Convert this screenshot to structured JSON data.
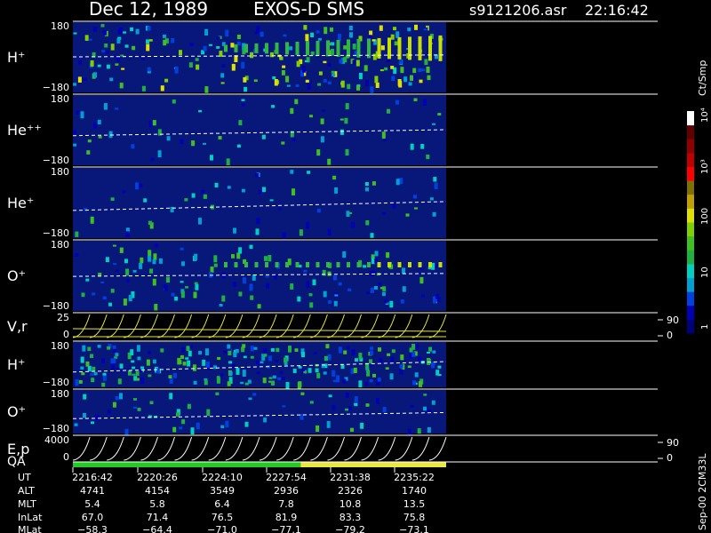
{
  "header": {
    "date": "Dec 12, 1989",
    "instrument": "EXOS-D SMS",
    "file": "s9121206.asr",
    "time": "22:16:42"
  },
  "colorbar": {
    "unit_label": "Ct/Smp",
    "ticks": [
      "1",
      "10",
      "100",
      "10³",
      "10⁴"
    ],
    "colors": [
      "#00007a",
      "#0000b4",
      "#0040e0",
      "#00a0d0",
      "#00d0c0",
      "#20b040",
      "#40c020",
      "#80d000",
      "#e0e000",
      "#c0a000",
      "#807000",
      "#ff0000",
      "#c00000",
      "#900000",
      "#600000",
      "#ffffff"
    ]
  },
  "colors": {
    "background": "#000000",
    "plot_bg": "#07187a",
    "trace": "#ffffff",
    "vr_curve": "#e8e840",
    "qa_green": "#22cc22",
    "qa_yellow": "#e8e840"
  },
  "vertical_note": "Sep-00 2CM33L",
  "chart_data": {
    "type": "heatmap",
    "panels": [
      {
        "label": "H⁺",
        "sup": "+",
        "base": "H",
        "y_tick_top": "180",
        "y_tick_bottom": "−180",
        "ylim": [
          -180,
          180
        ],
        "trace_value": [
          0,
          10
        ]
      },
      {
        "label": "He⁺⁺",
        "sup": "++",
        "base": "He",
        "y_tick_top": "180",
        "y_tick_bottom": "−180",
        "ylim": [
          -180,
          180
        ],
        "trace_value": [
          -30,
          0
        ]
      },
      {
        "label": "He⁺",
        "sup": "+",
        "base": "He",
        "y_tick_top": "180",
        "y_tick_bottom": "−180",
        "ylim": [
          -180,
          180
        ],
        "trace_value": [
          -40,
          5
        ]
      },
      {
        "label": "O⁺",
        "sup": "+",
        "base": "O",
        "y_tick_top": "180",
        "y_tick_bottom": "−180",
        "ylim": [
          -180,
          180
        ],
        "trace_value": [
          -5,
          10
        ]
      },
      {
        "label": "V,r",
        "sup": "",
        "base": "V,r",
        "y_tick_top": "25",
        "y_tick_bottom": "0",
        "right_tick_top": "90",
        "right_tick_bottom": "0"
      },
      {
        "label": "H⁺",
        "sup": "+",
        "base": "H",
        "y_tick_top": "180",
        "y_tick_bottom": "−180",
        "ylim": [
          -180,
          180
        ],
        "trace_value": [
          -60,
          20
        ]
      },
      {
        "label": "O⁺",
        "sup": "+",
        "base": "O",
        "y_tick_top": "180",
        "y_tick_bottom": "−180",
        "ylim": [
          -180,
          180
        ],
        "trace_value": [
          -60,
          -10
        ]
      },
      {
        "label": "E,p",
        "sup": "",
        "base": "E,p",
        "y_tick_top": "4000",
        "y_tick_bottom": "0",
        "right_tick_top": "90",
        "right_tick_bottom": "0"
      }
    ],
    "qa_label": "QA",
    "qa_segments": [
      {
        "status": "green",
        "from": 0.0,
        "to": 0.61
      },
      {
        "status": "yellow",
        "from": 0.61,
        "to": 1.0
      }
    ],
    "data_coverage_fraction": 0.6,
    "table": {
      "row_labels": [
        "UT",
        "ALT",
        "MLT",
        "InLat",
        "MLat"
      ],
      "columns": [
        [
          "2216:42",
          "4741",
          "5.4",
          "67.0",
          "−58.3"
        ],
        [
          "2220:26",
          "4154",
          "5.8",
          "71.4",
          "−64.4"
        ],
        [
          "2224:10",
          "3549",
          "6.4",
          "76.5",
          "−71.0"
        ],
        [
          "2227:54",
          "2936",
          "7.8",
          "81.9",
          "−77.1"
        ],
        [
          "2231:38",
          "2326",
          "10.8",
          "83.3",
          "−79.2"
        ],
        [
          "2235:22",
          "1740",
          "13.5",
          "75.8",
          "−73.1"
        ]
      ]
    }
  }
}
